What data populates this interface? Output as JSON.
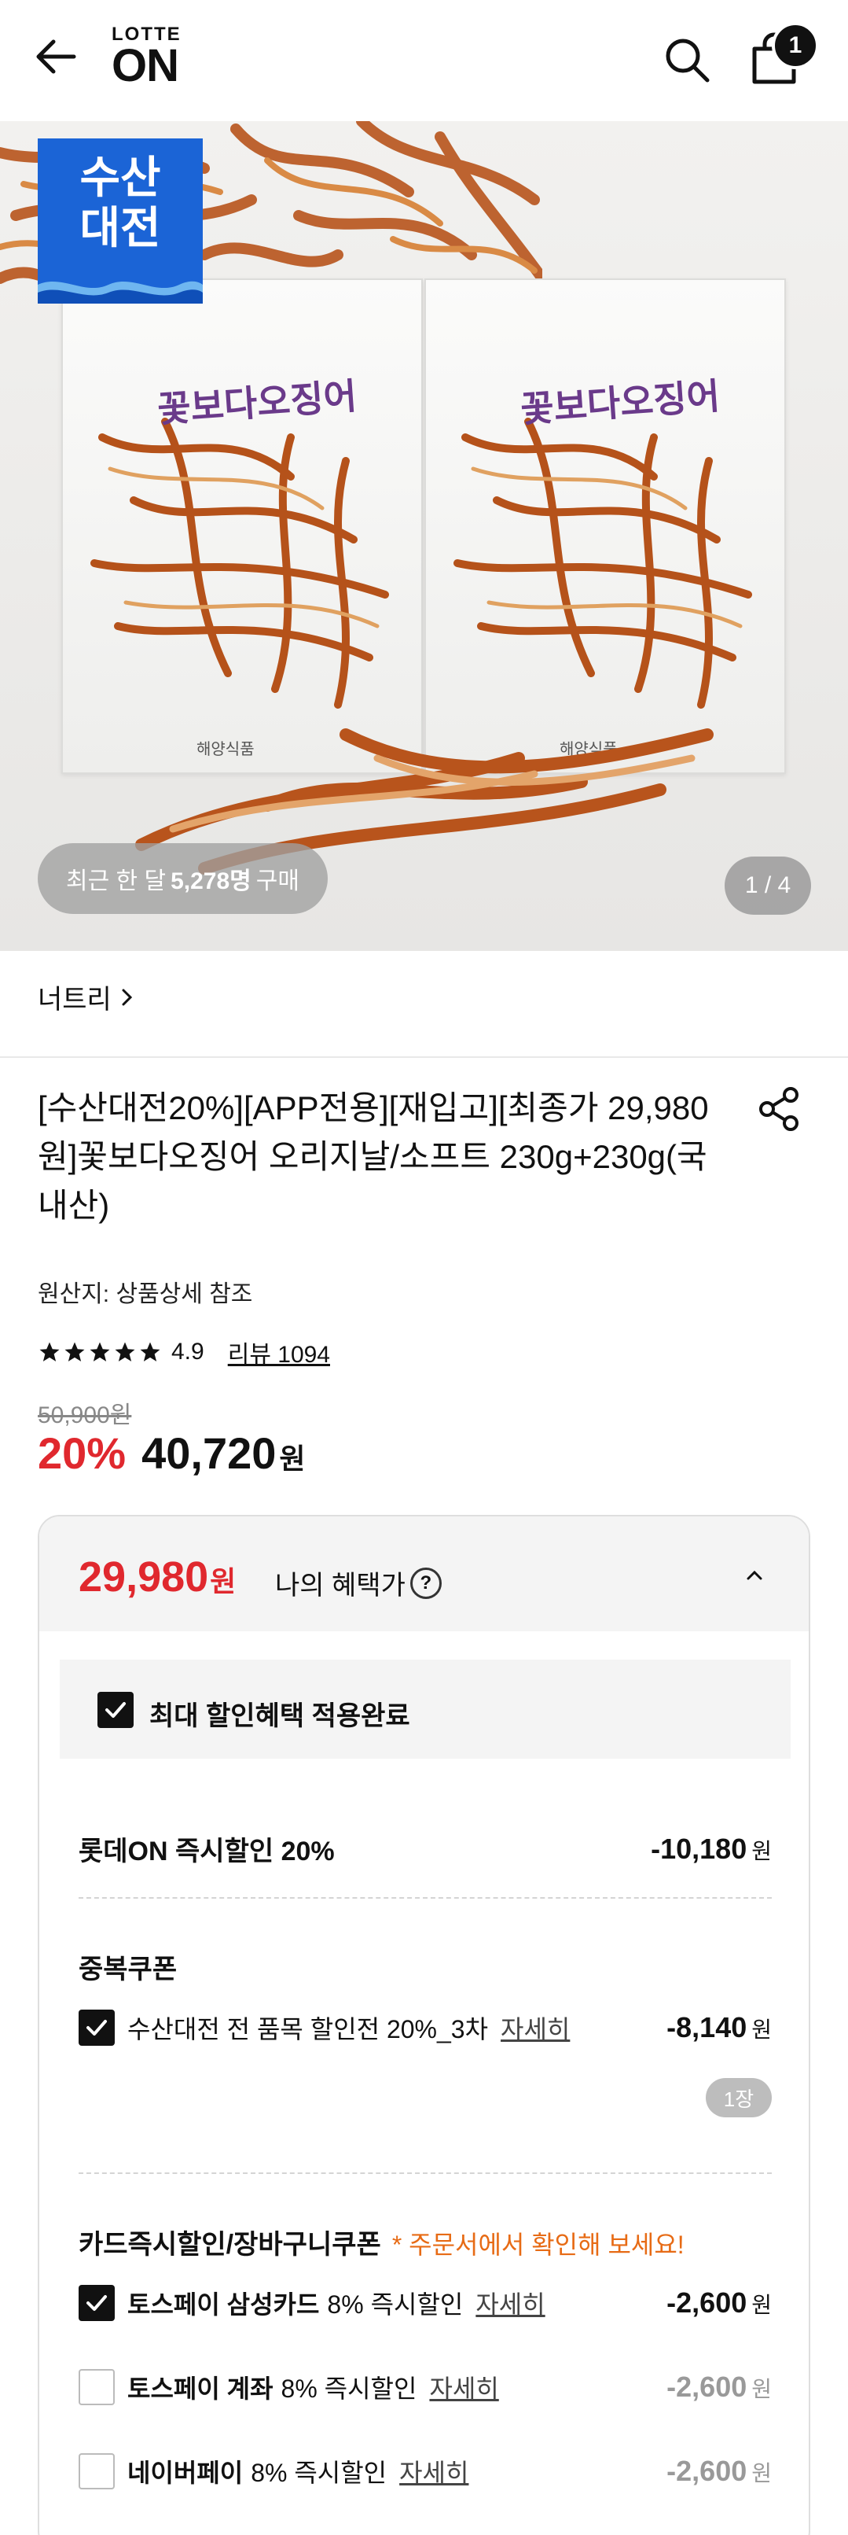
{
  "header": {
    "logo_top": "LOTTE",
    "logo_bottom": "ON",
    "cart_count": "1"
  },
  "hero": {
    "event_badge_line1": "수산",
    "event_badge_line2": "대전",
    "buyers_prefix": "최근 한 달",
    "buyers_count": "5,278명",
    "buyers_suffix": "구매",
    "pager": "1 / 4"
  },
  "brand": {
    "name": "너트리"
  },
  "product": {
    "title": "[수산대전20%][APP전용][재입고][최종가 29,980원]꽃보다오징어 오리지날/소프트 230g+230g(국내산)",
    "origin": "원산지: 상품상세 참조",
    "rating": "4.9",
    "rating_stars": 5,
    "review_link": "리뷰 1094",
    "original_price": "50,900원",
    "discount_rate": "20%",
    "price": "40,720",
    "price_unit": "원"
  },
  "benefit": {
    "final_price": "29,980",
    "final_unit": "원",
    "label": "나의 혜택가",
    "help": "?",
    "max_discount_label": "최대 할인혜택 적용완료",
    "instant": {
      "label": "롯데ON 즉시할인 20%",
      "amount": "-10,180",
      "unit": "원"
    },
    "coupon_section": "중복쿠폰",
    "coupon": {
      "label": "수산대전 전 품목 할인전 20%_3차",
      "detail": "자세히",
      "amount": "-8,140",
      "unit": "원",
      "count": "1장"
    },
    "card_section": "카드즉시할인/장바구니쿠폰",
    "card_note": "* 주문서에서 확인해 보세요!",
    "card_items": [
      {
        "bold": "토스페이 삼성카드",
        "rest": "8% 즉시할인",
        "detail": "자세히",
        "amount": "-2,600",
        "unit": "원",
        "checked": true
      },
      {
        "bold": "토스페이 계좌",
        "rest": "8% 즉시할인",
        "detail": "자세히",
        "amount": "-2,600",
        "unit": "원",
        "checked": false
      },
      {
        "bold": "네이버페이",
        "rest": "8% 즉시할인",
        "detail": "자세히",
        "amount": "-2,600",
        "unit": "원",
        "checked": false
      }
    ]
  }
}
